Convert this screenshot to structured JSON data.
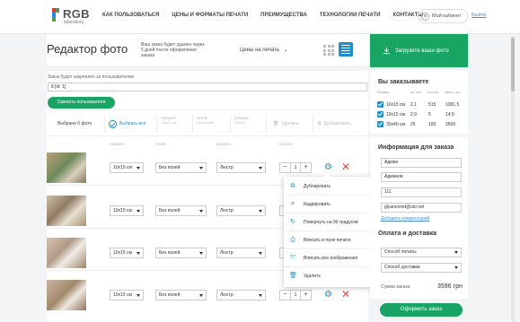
{
  "header": {
    "logo_text": "RGB",
    "logo_sub": "laboratory",
    "nav": [
      "КАК ПОЛЬЗОВАТЬСЯ",
      "ЦЕНЫ И ФОРМАТЫ ПЕЧАТИ",
      "ПРЕИМУЩЕСТВА",
      "ТЕХНОЛОГИИ ПЕЧАТИ",
      "КОНТАКТЫ"
    ],
    "cabinet_label": "Мой кабинет",
    "logout_label": "Выйти"
  },
  "editor": {
    "title": "Редактор фото",
    "note": "Ваш заказ будет удален через 5 дней после оформления заказа",
    "print_prices_label": "Цены на печать",
    "upload_label": "Загрузите ваши фото"
  },
  "assign": {
    "label": "Заказ будет закреплен за пользователем",
    "value": "8 [id: 1]",
    "change_user_label": "Сменить пользователя"
  },
  "toolbar": {
    "selected_label": "Выбрано 0 фото",
    "select_all_label": "Выбрать все",
    "size_head": "РАЗМЕР",
    "size_value": "10x15 см",
    "fields_head": "ПОЛЯ",
    "fields_value": "Без полей",
    "paper_head": "БУМАГА",
    "paper_value": "Люстр",
    "delete_label": "Удалить",
    "duplicate_label": "Дублировать"
  },
  "columns": {
    "size": "РАЗМЕР",
    "fields": "ПОЛЯ",
    "paper": "БУМАГА",
    "qty": "КОЛ-ВО"
  },
  "photos": [
    {
      "size": "10x15 см",
      "fields": "Без полей",
      "paper": "Люстр",
      "qty": "1"
    },
    {
      "size": "10x15 см",
      "fields": "Без полей",
      "paper": "Люстр",
      "qty": "1"
    },
    {
      "size": "10x15 см",
      "fields": "Без полей",
      "paper": "Люстр",
      "qty": "1"
    },
    {
      "size": "10x15 см",
      "fields": "Без полей",
      "paper": "Люстр",
      "qty": "1"
    }
  ],
  "stepper": {
    "minus": "−",
    "plus": "+"
  },
  "context_menu": [
    {
      "label": "Дублировать",
      "icon": "copy-icon"
    },
    {
      "label": "Кадрировать",
      "icon": "crop-icon"
    },
    {
      "label": "Повернуть на 90 градусов",
      "icon": "rotate-icon"
    },
    {
      "label": "Вписать в поле печати",
      "icon": "fit-print-icon"
    },
    {
      "label": "Вписать все изображения",
      "icon": "fit-all-icon"
    },
    {
      "label": "Удалить",
      "icon": "trash-icon"
    }
  ],
  "order_summary": {
    "title": "Вы заказываете",
    "heads": [
      "Размер",
      "за 1шт",
      "Кол-во",
      "Цена, грн"
    ],
    "rows": [
      {
        "size": "10x15 см",
        "unit": "2.1",
        "qty": "515",
        "price": "1081.5"
      },
      {
        "size": "10x15 см",
        "unit": "2.9",
        "qty": "5",
        "price": "14.5"
      },
      {
        "size": "30x40 см",
        "unit": "25",
        "qty": "100",
        "price": "2500"
      }
    ]
  },
  "order_info": {
    "title": "Информация для заказа",
    "first_name": "Админ",
    "last_name": "Админов",
    "phone": "111",
    "email": "glyanecnet@ukr.net",
    "add_comment_label": "Добавить комментарий"
  },
  "payment": {
    "title": "Оплата и доставка",
    "pay_placeholder": "Способ оплаты",
    "delivery_placeholder": "Способ доставки",
    "sum_label": "Сумма заказа",
    "sum_value": "3596 грн",
    "checkout_label": "Оформить заказ"
  },
  "colors": {
    "accent_green": "#18a463",
    "accent_blue": "#1f8fc7",
    "delete_red": "#e24c4c"
  }
}
